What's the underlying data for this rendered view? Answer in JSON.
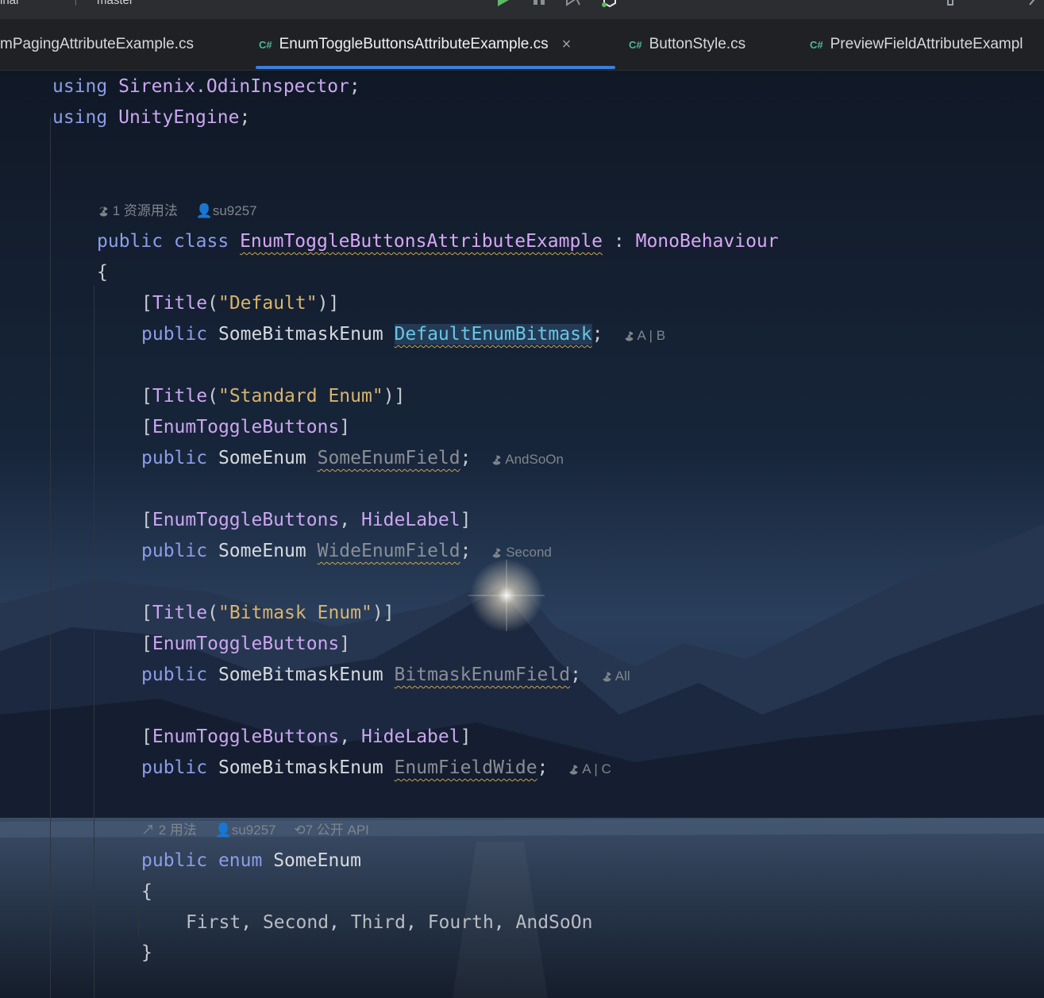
{
  "toolbar": {
    "left_text": "inal",
    "branch": "master"
  },
  "tabs": [
    {
      "label": "mPagingAttributeExample.cs",
      "lang": "",
      "active": false
    },
    {
      "label": "EnumToggleButtonsAttributeExample.cs",
      "lang": "C#",
      "active": true
    },
    {
      "label": "ButtonStyle.cs",
      "lang": "C#",
      "active": false
    },
    {
      "label": "PreviewFieldAttributeExampl",
      "lang": "C#",
      "active": false
    }
  ],
  "tab_close_glyph": "×",
  "code": {
    "using1_kw": "using",
    "using1_ns": "Sirenix.OdinInspector",
    "using2_kw": "using",
    "using2_ns": "UnityEngine",
    "hint_class_usages": "1 资源用法",
    "hint_class_author": "su9257",
    "class_kw1": "public",
    "class_kw2": "class",
    "class_name": "EnumToggleButtonsAttributeExample",
    "class_colon": ":",
    "class_base": "MonoBehaviour",
    "brace_open": "{",
    "brace_close": "}",
    "attr_title": "Title",
    "attr_title_default": "\"Default\"",
    "attr_title_standard": "\"Standard Enum\"",
    "attr_title_bitmask": "\"Bitmask Enum\"",
    "attr_enum_toggle": "EnumToggleButtons",
    "attr_hide_label": "HideLabel",
    "kw_public": "public",
    "type_bitmask": "SomeBitmaskEnum",
    "type_enum": "SomeEnum",
    "field_default": "DefaultEnumBitmask",
    "field_some": "SomeEnumField",
    "field_wide": "WideEnumField",
    "field_bitmask": "BitmaskEnumField",
    "field_wide_bitmask": "EnumFieldWide",
    "inlay_default": "A | B",
    "inlay_some": "AndSoOn",
    "inlay_wide": "Second",
    "inlay_bitmask": "All",
    "inlay_wide_bitmask": "A | C",
    "hint_enum_usages": "2 用法",
    "hint_enum_author": "su9257",
    "hint_enum_api": "7 公开 API",
    "enum_kw": "enum",
    "enum_name": "SomeEnum",
    "enum_values": [
      "First",
      "Second",
      "Third",
      "Fourth",
      "AndSoOn"
    ]
  },
  "colors": {
    "keyword": "#8c9dea",
    "attribute": "#cba6f0",
    "string": "#d8b46c",
    "accent_tab": "#3d7dde",
    "csharp_badge": "#4fb89a"
  }
}
